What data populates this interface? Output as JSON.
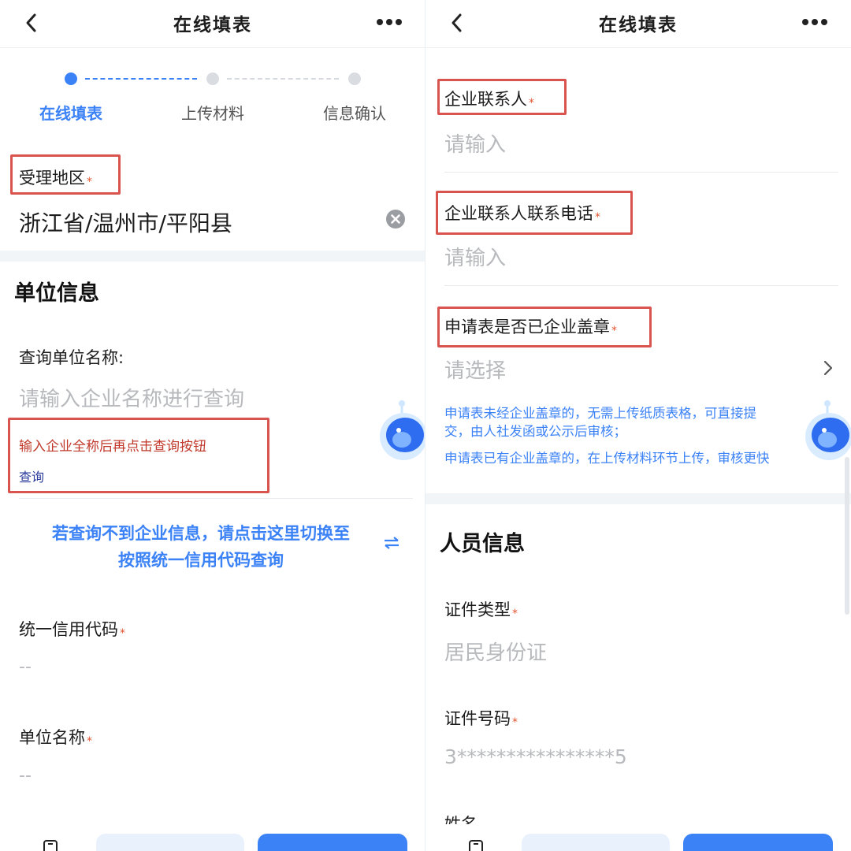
{
  "nav": {
    "title": "在线填表"
  },
  "steps": [
    "在线填表",
    "上传材料",
    "信息确认"
  ],
  "left": {
    "region_label": "受理地区",
    "region_value": "浙江省/温州市/平阳县",
    "unit_section_title": "单位信息",
    "query_label": "查询单位名称:",
    "query_placeholder": "请输入企业名称进行查询",
    "query_hint": "输入企业全称后再点击查询按钮",
    "query_link": "查询",
    "switch_line1": "若查询不到企业信息，请点击这里切换至",
    "switch_line2": "按照统一信用代码查询",
    "credit_code_label": "统一信用代码",
    "credit_code_value": "--",
    "unit_name_label": "单位名称",
    "unit_name_value": "--"
  },
  "right": {
    "contact_label": "企业联系人",
    "contact_placeholder": "请输入",
    "phone_label": "企业联系人联系电话",
    "phone_placeholder": "请输入",
    "seal_label": "申请表是否已企业盖章",
    "seal_placeholder": "请选择",
    "seal_note1_line1": "申请表未经企业盖章的，无需上传纸质表格，可直接提",
    "seal_note1_line2": "交，由人社发函或公示后审核；",
    "seal_note2": "申请表已有企业盖章的，在上传材料环节上传，审核更快",
    "person_section_title": "人员信息",
    "id_type_label": "证件类型",
    "id_type_value": "居民身份证",
    "id_number_label": "证件号码",
    "id_number_value": "3****************5",
    "name_label": "姓名"
  },
  "required_mark": "*",
  "colors": {
    "accent": "#3b82f6",
    "required": "#e0552f",
    "highlight_box": "#d9534f",
    "hint_red": "#c0392b"
  },
  "icons": [
    "back-icon",
    "more-icon",
    "clear-icon",
    "switch-icon",
    "chevron-right-icon",
    "robot-assistant-icon"
  ]
}
